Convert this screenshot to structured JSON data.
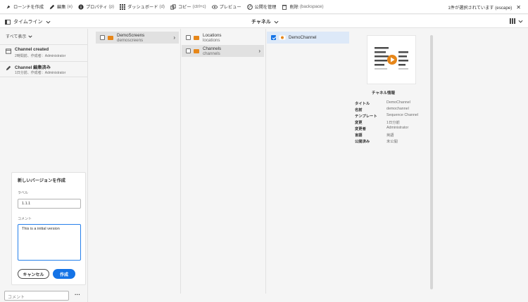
{
  "toolbar": {
    "items": [
      {
        "label": "ローンチを作成",
        "shortcut": "",
        "icon": "rocket-icon"
      },
      {
        "label": "編集",
        "shortcut": "(e)",
        "icon": "pencil-icon"
      },
      {
        "label": "プロパティ",
        "shortcut": "(p)",
        "icon": "info-icon"
      },
      {
        "label": "ダッシュボード",
        "shortcut": "(d)",
        "icon": "grid-icon"
      },
      {
        "label": "コピー",
        "shortcut": "(ctrl+c)",
        "icon": "copy-icon"
      },
      {
        "label": "プレビュー",
        "shortcut": "",
        "icon": "eye-icon"
      },
      {
        "label": "公開を管理",
        "shortcut": "",
        "icon": "globe-icon"
      },
      {
        "label": "削除",
        "shortcut": "(backspace)",
        "icon": "trash-icon"
      }
    ],
    "selection_status": "1件が選択されています (escape)",
    "close_label": "✕"
  },
  "subbar": {
    "rail_label": "タイムライン",
    "title": "チャネル"
  },
  "rail": {
    "filter_label": "すべて表示",
    "items": [
      {
        "title": "Channel created",
        "meta": "2時間前、作成者：Administrator"
      },
      {
        "title": "Channel 編集済み",
        "meta": "1日分前、作成者：Administrator"
      }
    ]
  },
  "version_form": {
    "title": "新しいバージョンを作成",
    "label_caption": "ラベル",
    "label_value": "1.1.1",
    "comment_caption": "コメント",
    "comment_value": "This is a initial version",
    "cancel_label": "キャンセル",
    "submit_label": "作成"
  },
  "comment_input": {
    "placeholder": "コメント"
  },
  "columns": {
    "col1": [
      {
        "title": "DemoScreens",
        "subtitle": "demoscreens"
      }
    ],
    "col2": [
      {
        "title": "Locations",
        "subtitle": "locations"
      },
      {
        "title": "Channels",
        "subtitle": "channels"
      }
    ],
    "col3": [
      {
        "title": "DemoChannel"
      }
    ]
  },
  "info": {
    "heading": "チャネル情報",
    "rows": [
      {
        "key": "タイトル",
        "value": "DemoChannel"
      },
      {
        "key": "名前",
        "value": "demochannel"
      },
      {
        "key": "テンプレート",
        "value": "Sequence Channel"
      },
      {
        "key": "変更",
        "value": "1日分前"
      },
      {
        "key": "変更者",
        "value": "Administrator"
      },
      {
        "key": "言語",
        "value": "英語"
      },
      {
        "key": "公開済み",
        "value": "未公開"
      }
    ]
  },
  "colors": {
    "accent": "#1473e6",
    "folder": "#e68619",
    "play": "#e68619"
  }
}
